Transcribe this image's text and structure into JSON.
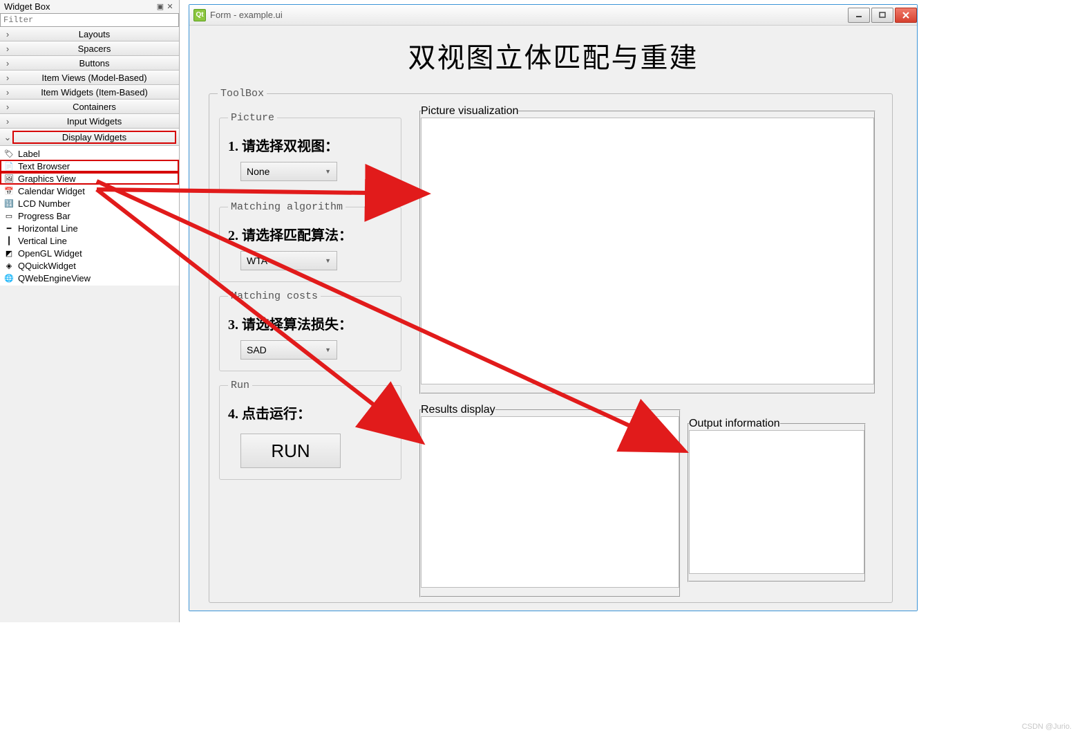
{
  "widgetbox": {
    "title": "Widget Box",
    "filter_placeholder": "Filter",
    "categories": [
      {
        "label": "Layouts",
        "open": false
      },
      {
        "label": "Spacers",
        "open": false
      },
      {
        "label": "Buttons",
        "open": false
      },
      {
        "label": "Item Views (Model-Based)",
        "open": false
      },
      {
        "label": "Item Widgets (Item-Based)",
        "open": false
      },
      {
        "label": "Containers",
        "open": false
      },
      {
        "label": "Input Widgets",
        "open": false
      },
      {
        "label": "Display Widgets",
        "open": true,
        "highlight": true,
        "items": [
          {
            "label": "Label",
            "icon": "tag-icon"
          },
          {
            "label": "Text Browser",
            "icon": "textbrowser-icon",
            "highlight": true
          },
          {
            "label": "Graphics View",
            "icon": "graphicsview-icon",
            "highlight": true
          },
          {
            "label": "Calendar Widget",
            "icon": "calendar-icon"
          },
          {
            "label": "LCD Number",
            "icon": "lcd-icon"
          },
          {
            "label": "Progress Bar",
            "icon": "progress-icon"
          },
          {
            "label": "Horizontal Line",
            "icon": "hline-icon"
          },
          {
            "label": "Vertical Line",
            "icon": "vline-icon"
          },
          {
            "label": "OpenGL Widget",
            "icon": "opengl-icon"
          },
          {
            "label": "QQuickWidget",
            "icon": "qquick-icon"
          },
          {
            "label": "QWebEngineView",
            "icon": "web-icon"
          }
        ]
      }
    ]
  },
  "form": {
    "window_title": "Form - example.ui",
    "heading": "双视图立体匹配与重建",
    "toolbox_legend": "ToolBox",
    "sections": {
      "picture": {
        "legend": "Picture",
        "step": "1. 请选择双视图：",
        "combo": "None"
      },
      "algo": {
        "legend": "Matching algorithm",
        "step": "2. 请选择匹配算法：",
        "combo": "WTA"
      },
      "costs": {
        "legend": "Matching costs",
        "step": "3. 请选择算法损失：",
        "combo": "SAD"
      },
      "run": {
        "legend": "Run",
        "step": "4. 点击运行：",
        "button": "RUN"
      }
    },
    "picture_vis_legend": "Picture visualization",
    "results_legend": "Results display",
    "output_legend": "Output information"
  },
  "watermark": "CSDN @Jurio."
}
